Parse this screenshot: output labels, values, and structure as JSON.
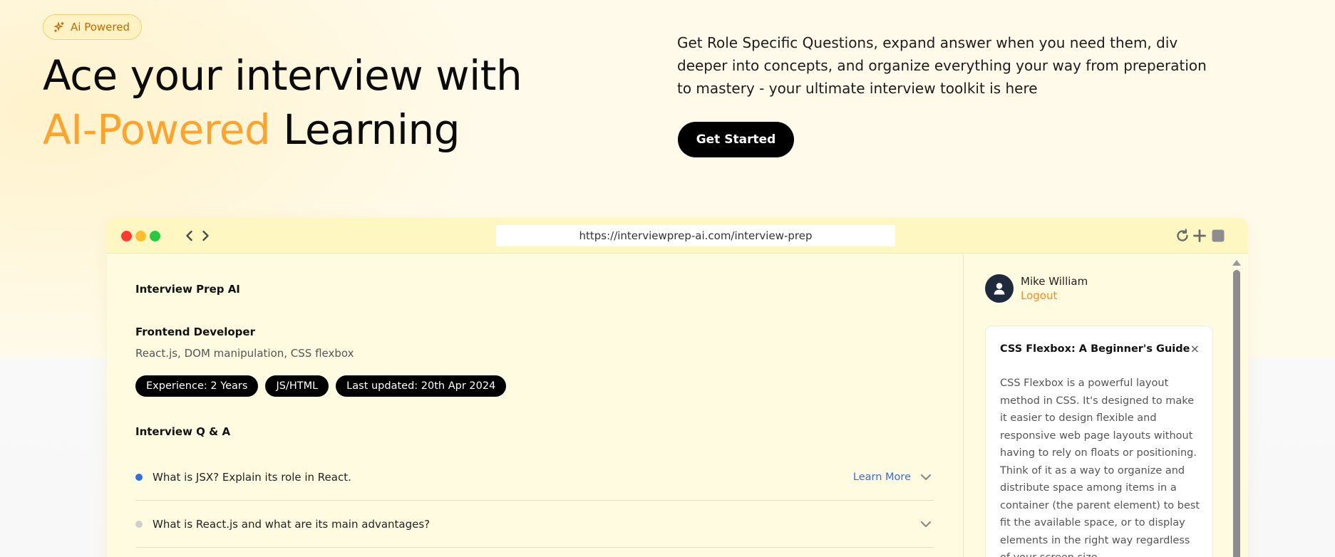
{
  "hero": {
    "badge_label": "Ai Powered",
    "headline_line1": "Ace your interview with",
    "headline_accent": "AI-Powered",
    "headline_rest": "Learning",
    "description": "Get Role Specific Questions, expand answer when you need them, div deeper into concepts, and organize everything your way from preperation to mastery - your ultimate interview toolkit is here",
    "cta_label": "Get Started"
  },
  "browser": {
    "url": "https://interviewprep-ai.com/interview-prep"
  },
  "app": {
    "title": "Interview Prep AI",
    "role": "Frontend Developer",
    "topics": "React.js, DOM manipulation, CSS flexbox",
    "pills": [
      "Experience: 2 Years",
      "JS/HTML",
      "Last updated: 20th Apr 2024"
    ],
    "qa_heading": "Interview Q & A",
    "questions": [
      {
        "text": "What is JSX? Explain its role in React.",
        "learn_more": "Learn More",
        "bullet_color": "#2f6fe8"
      },
      {
        "text": "What is React.js and what are its main advantages?",
        "learn_more": "",
        "bullet_color": "#cfcfcf"
      }
    ]
  },
  "sidebar": {
    "user_name": "Mike William",
    "logout_label": "Logout",
    "article": {
      "title": "CSS Flexbox: A Beginner's Guide",
      "close": "×",
      "body": "CSS Flexbox is a powerful layout method in CSS. It's designed to make it easier to design flexible and responsive web page layouts without having to rely on floats or positioning. Think of it as a way to organize and distribute space among items in a container (the parent element) to best fit the available space, or to display elements in the right way regardless of your screen size."
    }
  },
  "colors": {
    "accent_orange": "#ffa32b",
    "logout_orange": "#ff8a1f",
    "link_blue": "#3a6bd9",
    "browser_bar": "#fff7c2"
  },
  "icons": [
    "sparkle-icon",
    "chevron-left-icon",
    "chevron-right-icon",
    "refresh-icon",
    "plus-icon",
    "square-icon",
    "user-icon",
    "chevron-down-icon",
    "close-icon"
  ]
}
